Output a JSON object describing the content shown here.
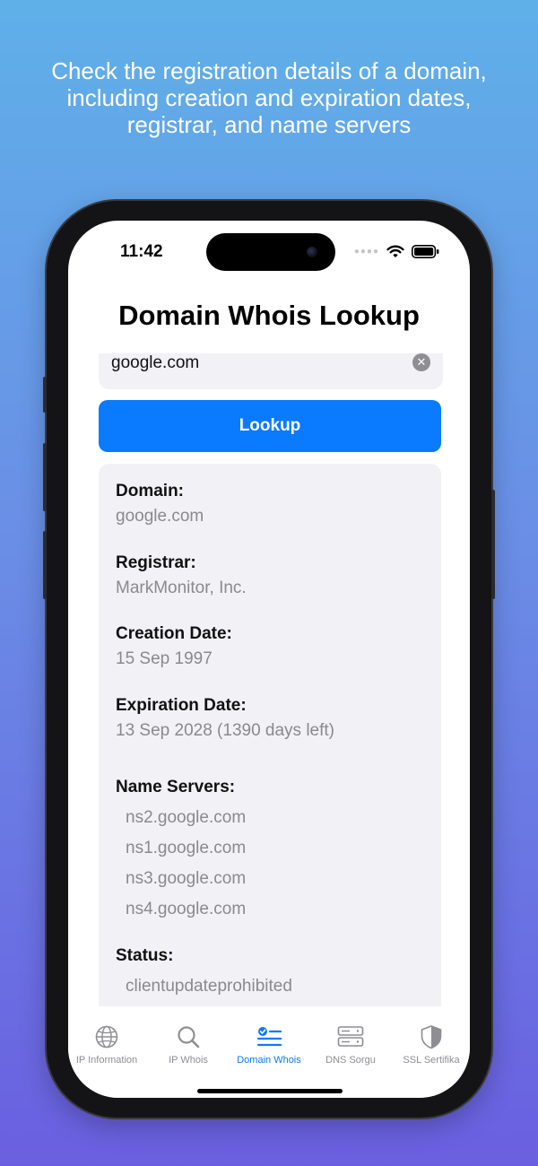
{
  "headline": "Check the registration details of a domain, including creation and expiration dates, registrar, and name servers",
  "status_bar": {
    "time": "11:42"
  },
  "app": {
    "title": "Domain Whois Lookup",
    "search": {
      "value": "google.com"
    },
    "lookup_label": "Lookup"
  },
  "result": {
    "domain": {
      "label": "Domain:",
      "value": "google.com"
    },
    "registrar": {
      "label": "Registrar:",
      "value": "MarkMonitor, Inc."
    },
    "creation": {
      "label": "Creation Date:",
      "value": "15 Sep 1997"
    },
    "expiration": {
      "label": "Expiration Date:",
      "value": "13 Sep 2028 (1390 days left)"
    },
    "name_servers": {
      "label": "Name Servers:",
      "items": [
        "ns2.google.com",
        "ns1.google.com",
        "ns3.google.com",
        "ns4.google.com"
      ]
    },
    "status": {
      "label": "Status:",
      "items": [
        "clientupdateprohibited"
      ]
    }
  },
  "tabs": [
    {
      "label": "IP Information",
      "icon": "globe-icon"
    },
    {
      "label": "IP Whois",
      "icon": "magnifier-icon"
    },
    {
      "label": "Domain Whois",
      "icon": "checklist-icon",
      "active": true
    },
    {
      "label": "DNS Sorgu",
      "icon": "server-icon"
    },
    {
      "label": "SSL Sertifika",
      "icon": "shield-icon"
    }
  ],
  "colors": {
    "accent": "#0a7aff",
    "card_bg": "#f1f1f6",
    "muted_text": "#8a8a8e"
  }
}
